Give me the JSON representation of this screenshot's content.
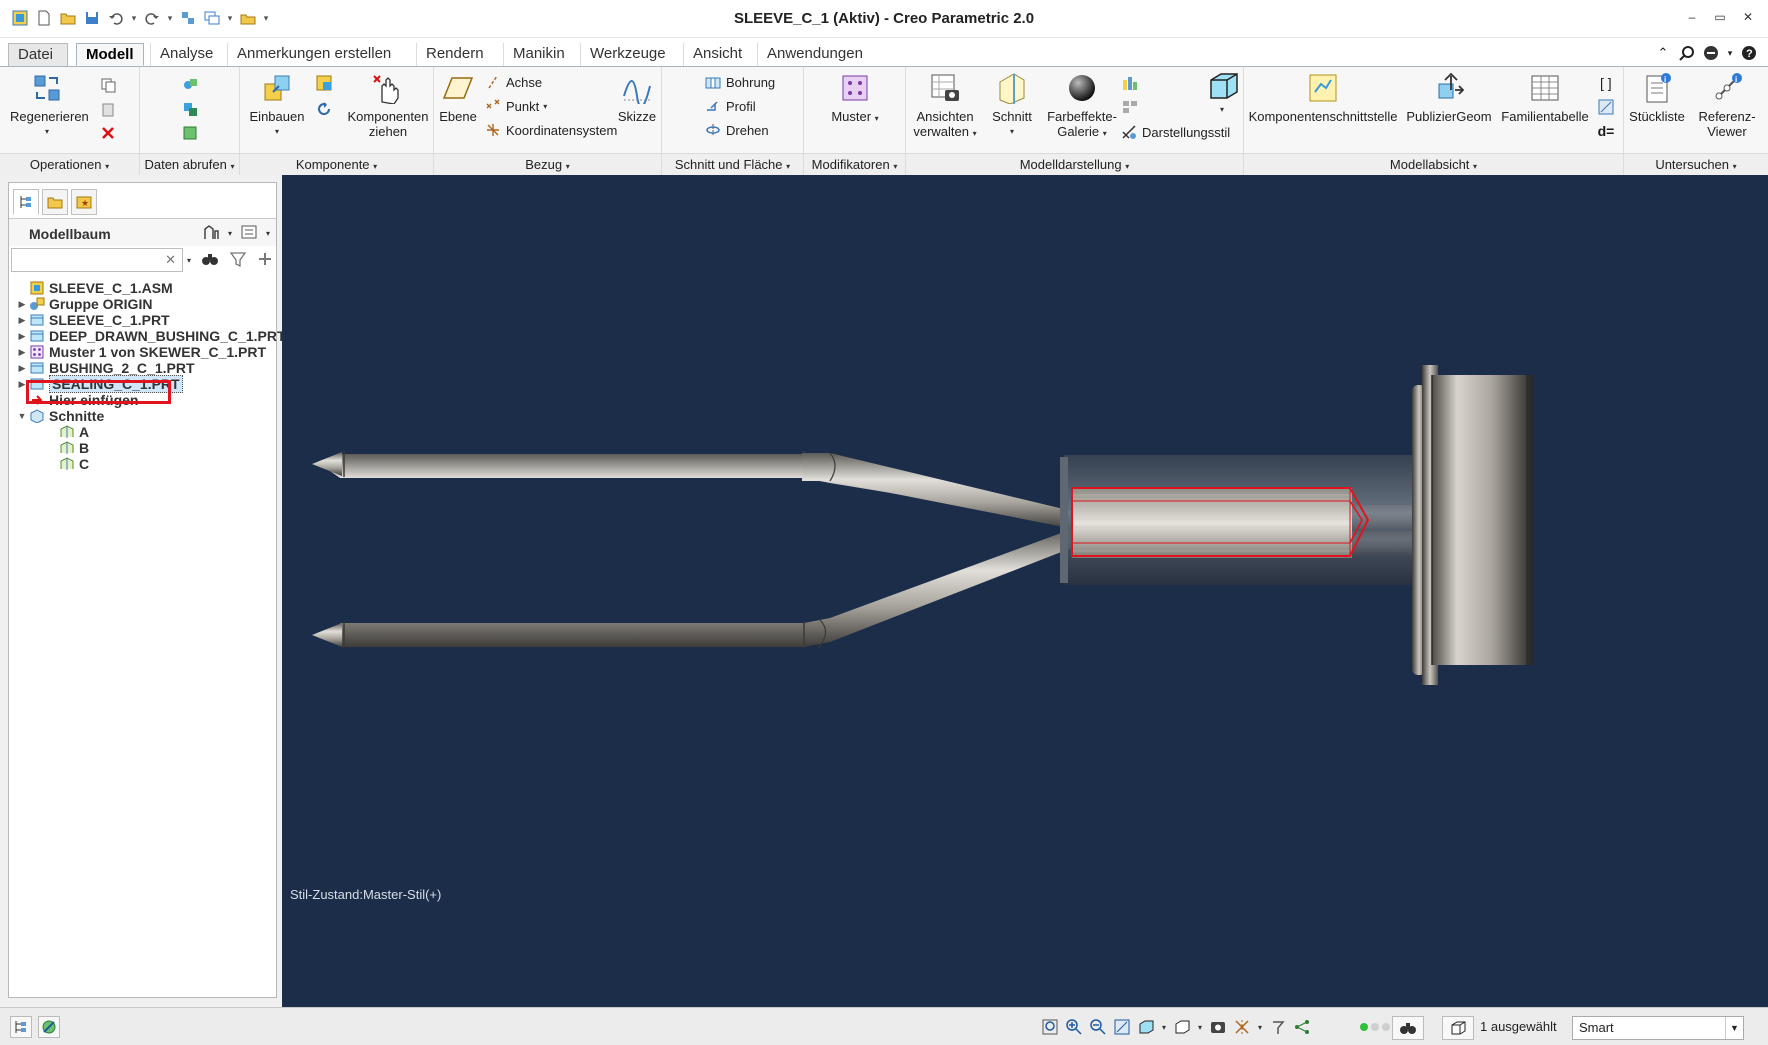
{
  "window": {
    "title": "SLEEVE_C_1 (Aktiv) - Creo Parametric 2.0"
  },
  "menu": {
    "file": "Datei",
    "tabs": [
      "Modell",
      "Analyse",
      "Anmerkungen erstellen",
      "Rendern",
      "Manikin",
      "Werkzeuge",
      "Ansicht",
      "Anwendungen"
    ],
    "active_tab": "Modell"
  },
  "ribbon": {
    "regenerate": "Regenerieren",
    "assemble": "Einbauen",
    "drag_components_1": "Komponenten",
    "drag_components_2": "ziehen",
    "plane": "Ebene",
    "axis": "Achse",
    "point": "Punkt",
    "csys": "Koordinatensystem",
    "sketch": "Skizze",
    "hole": "Bohrung",
    "extrude": "Profil",
    "revolve": "Drehen",
    "pattern": "Muster",
    "manage_views_1": "Ansichten",
    "manage_views_2": "verwalten",
    "section": "Schnitt",
    "appearance_1": "Farbeffekte-",
    "appearance_2": "Galerie",
    "display_style": "Darstellungsstil",
    "component_interface": "Komponentenschnittstelle",
    "publish_geom": "PublizierGeom",
    "family_table": "Familientabelle",
    "bom": "Stückliste",
    "ref_viewer_1": "Referenz-",
    "ref_viewer_2": "Viewer",
    "relations": "d=",
    "groups": {
      "operations": "Operationen",
      "get_data": "Daten abrufen",
      "component": "Komponente",
      "datum": "Bezug",
      "cut_surface": "Schnitt und Fläche",
      "modifiers": "Modifikatoren",
      "model_display": "Modelldarstellung",
      "model_intent": "Modellabsicht",
      "investigate": "Untersuchen"
    }
  },
  "model_tree": {
    "title": "Modellbaum",
    "search_placeholder": "",
    "items": [
      {
        "label": "SLEEVE_C_1.ASM",
        "icon": "assembly-icon",
        "expandable": false,
        "indent": 0
      },
      {
        "label": "Gruppe ORIGIN",
        "icon": "group-icon",
        "expandable": true,
        "indent": 0
      },
      {
        "label": "SLEEVE_C_1.PRT",
        "icon": "part-icon",
        "expandable": true,
        "indent": 0
      },
      {
        "label": "DEEP_DRAWN_BUSHING_C_1.PRT",
        "icon": "part-icon",
        "expandable": true,
        "indent": 0
      },
      {
        "label": "Muster 1 von SKEWER_C_1.PRT",
        "icon": "pattern-icon",
        "expandable": true,
        "indent": 0
      },
      {
        "label": "BUSHING_2_C_1.PRT",
        "icon": "part-icon",
        "expandable": true,
        "indent": 0
      },
      {
        "label": "SEALING_C_1.PRT",
        "icon": "part-icon",
        "expandable": true,
        "indent": 0,
        "selected": true
      },
      {
        "label": "Hier einfügen",
        "icon": "insert-arrow-icon",
        "expandable": false,
        "indent": 0
      },
      {
        "label": "Schnitte",
        "icon": "sections-folder-icon",
        "expandable": true,
        "expanded": true,
        "indent": 0
      },
      {
        "label": "A",
        "icon": "section-icon",
        "expandable": false,
        "indent": 1
      },
      {
        "label": "B",
        "icon": "section-icon",
        "expandable": false,
        "indent": 1
      },
      {
        "label": "C",
        "icon": "section-icon",
        "expandable": false,
        "indent": 1
      }
    ]
  },
  "viewport": {
    "style_state": "Stil-Zustand:Master-Stil(+)",
    "background": "#1b2d49",
    "highlight_color": "#e0141e"
  },
  "status": {
    "selected_count": "1 ausgewählt",
    "filter": "Smart"
  }
}
